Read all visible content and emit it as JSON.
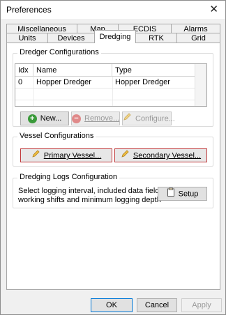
{
  "window": {
    "title": "Preferences",
    "close_glyph": "✕"
  },
  "tabs": {
    "row1": [
      "Miscellaneous",
      "Map",
      "ECDIS",
      "Alarms"
    ],
    "row2": [
      "Units",
      "Devices",
      "Dredging",
      "RTK",
      "Grid"
    ],
    "active": "Dredging"
  },
  "dredger_config": {
    "label": "Dredger Configurations",
    "columns": [
      "Idx",
      "Name",
      "Type"
    ],
    "rows": [
      {
        "idx": "0",
        "name": "Hopper Dredger",
        "type": "Hopper Dredger"
      }
    ],
    "new_label": "New...",
    "remove_label": "Remove...",
    "configure_label": "Configure..."
  },
  "vessel_config": {
    "label": "Vessel Configurations",
    "primary_label": "Primary Vessel...",
    "secondary_label": "Secondary Vessel..."
  },
  "logs_config": {
    "label": "Dredging Logs Configuration",
    "description_line1": "Select logging interval, included data fields,",
    "description_line2": "working shifts and minimum logging depth",
    "setup_label": "Setup"
  },
  "footer": {
    "ok": "OK",
    "cancel": "Cancel",
    "apply": "Apply"
  },
  "colors": {
    "accent": "#0078d7",
    "add_green": "#3a9a3a",
    "remove_red": "#d06060",
    "highlight_red": "#c0393b"
  }
}
